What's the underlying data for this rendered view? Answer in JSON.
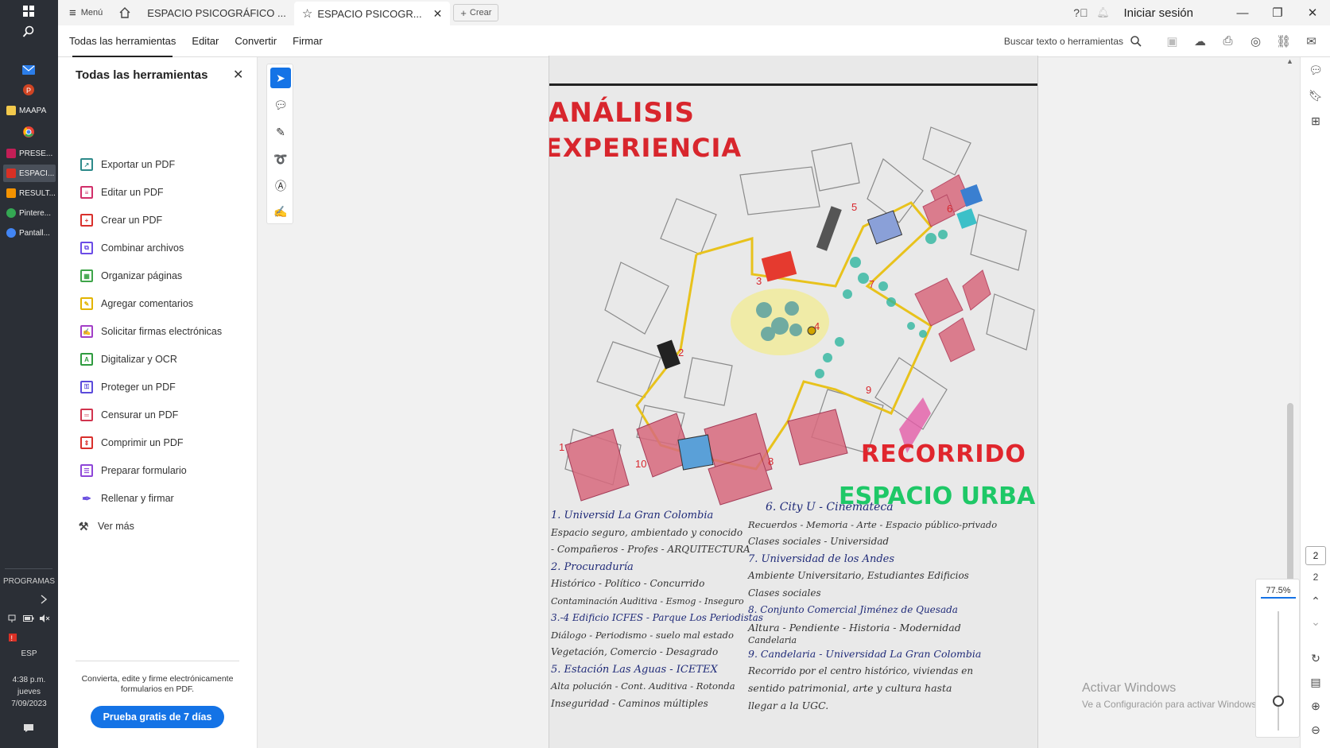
{
  "taskbar": {
    "apps": [
      {
        "label": "MAAPA",
        "color": "#f2c94c"
      },
      {
        "label": "",
        "color": "#ea4335"
      },
      {
        "label": "PRESE...",
        "color": "#c21e56"
      },
      {
        "label": "ESPACI...",
        "color": "#d93025"
      },
      {
        "label": "RESULT...",
        "color": "#f39200"
      },
      {
        "label": "Pintere...",
        "color": "#34a853"
      },
      {
        "label": "Pantall...",
        "color": "#4285f4"
      }
    ],
    "programs_label": "PROGRAMAS",
    "language": "ESP",
    "time": "4:38 p.m.",
    "weekday": "jueves",
    "date": "7/09/2023"
  },
  "titlebar": {
    "menu_label": "Menú",
    "tabs": [
      {
        "label": "ESPACIO PSICOGRÁFICO ..."
      },
      {
        "label": "ESPACIO PSICOGR..."
      }
    ],
    "new_tab_label": "Crear",
    "signin_label": "Iniciar sesión"
  },
  "menubar": {
    "items": [
      "Todas las herramientas",
      "Editar",
      "Convertir",
      "Firmar"
    ],
    "search_label": "Buscar texto o herramientas"
  },
  "tools_panel": {
    "title": "Todas las herramientas",
    "items": [
      {
        "label": "Exportar un PDF",
        "color": "#2d8a8a"
      },
      {
        "label": "Editar un PDF",
        "color": "#d12f6a"
      },
      {
        "label": "Crear un PDF",
        "color": "#d9302c"
      },
      {
        "label": "Combinar archivos",
        "color": "#6b4ce6"
      },
      {
        "label": "Organizar páginas",
        "color": "#3fa54a"
      },
      {
        "label": "Agregar comentarios",
        "color": "#e3b400"
      },
      {
        "label": "Solicitar firmas electrónicas",
        "color": "#a23fc7"
      },
      {
        "label": "Digitalizar y OCR",
        "color": "#2f9b3f"
      },
      {
        "label": "Proteger un PDF",
        "color": "#5b4bdb"
      },
      {
        "label": "Censurar un PDF",
        "color": "#d1344e"
      },
      {
        "label": "Comprimir un PDF",
        "color": "#d9302c"
      },
      {
        "label": "Preparar formulario",
        "color": "#8e46d8"
      },
      {
        "label": "Rellenar y firmar",
        "color": "#6a4fe0"
      },
      {
        "label": "Ver más",
        "color": "#444444"
      }
    ],
    "promo_text": "Convierta, edite y firme electrónicamente formularios en PDF.",
    "trial_button": "Prueba gratis de 7 días"
  },
  "document": {
    "title_line1": "ANÁLISIS",
    "title_line2": "EXPERIENCIA",
    "subtitle_line1": "RECORRIDO",
    "subtitle_line2": "ESPACIO URBANO",
    "map_numbers": [
      "1",
      "2",
      "3",
      "4",
      "5",
      "6",
      "7",
      "8",
      "9",
      "10"
    ],
    "notes_left": [
      "1. Universid La Gran Colombia",
      "Espacio seguro, ambientado y conocido",
      "- Compañeros - Profes - ARQUITECTURA",
      "2. Procuraduría",
      "Histórico - Político - Concurrido",
      "Contaminación Auditiva - Esmog - Inseguro",
      "3.-4 Edificio ICFES - Parque Los Periodistas",
      "Diálogo - Periodismo - suelo mal estado",
      "Vegetación, Comercio - Desagrado",
      "5. Estación Las Aguas - ICETEX",
      "Alta polución - Cont. Auditiva - Rotonda",
      "Inseguridad - Caminos múltiples"
    ],
    "notes_right": [
      "6. City U - Cinemateca",
      "Recuerdos - Memoria - Arte - Espacio público-privado",
      "Clases sociales - Universidad",
      "7. Universidad de los Andes",
      "Ambiente Universitario, Estudiantes Edificios",
      "Clases sociales",
      "8. Conjunto Comercial Jiménez de Quesada",
      "Altura - Pendiente - Historia - Modernidad",
      "Candelaria",
      "9. Candelaria - Universidad La Gran Colombia",
      "Recorrido por el centro histórico, viviendas en",
      "sentido patrimonial, arte y cultura hasta",
      "llegar a la UGC."
    ]
  },
  "watermark": {
    "line1": "Activar Windows",
    "line2": "Ve a Configuración para activar Windows."
  },
  "zoom": {
    "value": "77.5%",
    "level": 0.75
  },
  "page_nav": {
    "current": "2",
    "total": "2"
  }
}
